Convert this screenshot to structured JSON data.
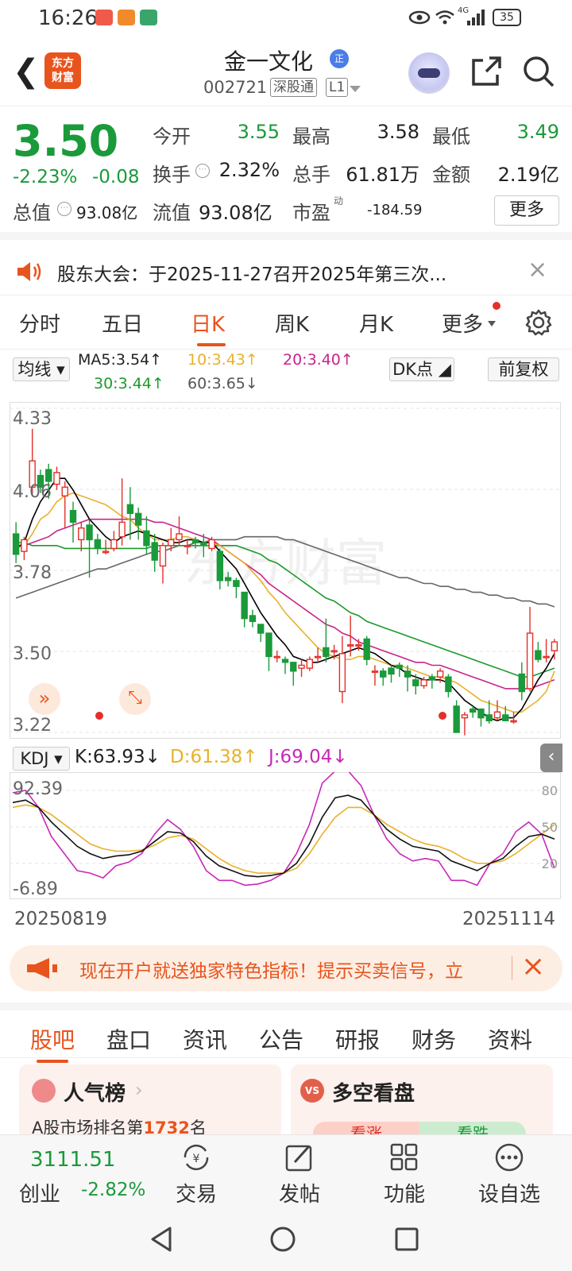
{
  "status_bar": {
    "time": "16:26",
    "battery": "35",
    "network": "4G"
  },
  "header": {
    "logo_text": "东方财富",
    "stock_name": "金一文化",
    "badge": "正",
    "stock_code": "002721",
    "tag_1": "深股通",
    "tag_2": "L1"
  },
  "quote": {
    "price": "3.50",
    "change_pct": "-2.23%",
    "change_amt": "-0.08",
    "open_label": "今开",
    "open_value": "3.55",
    "high_label": "最高",
    "high_value": "3.58",
    "low_label": "最低",
    "low_value": "3.49",
    "turnover_label": "换手",
    "turnover_value": "2.32%",
    "volume_label": "总手",
    "volume_value": "61.81万",
    "amount_label": "金额",
    "amount_value": "2.19亿",
    "total_value_label": "总值",
    "total_value_value": "93.08亿",
    "float_value_label": "流值",
    "float_value_value": "93.08亿",
    "pe_label": "市盈",
    "pe_sup": "动",
    "pe_value": "-184.59",
    "more_label": "更多"
  },
  "notice": {
    "text": "股东大会：于2025-11-27召开2025年第三次..."
  },
  "chart_tabs": [
    {
      "label": "分时"
    },
    {
      "label": "五日"
    },
    {
      "label": "日K"
    },
    {
      "label": "周K"
    },
    {
      "label": "月K"
    },
    {
      "label": "更多"
    }
  ],
  "ma_legend": {
    "selector": "均线",
    "ma5": "MA5:3.54↑",
    "ma10": "10:3.43↑",
    "ma20": "20:3.40↑",
    "ma30": "30:3.44↑",
    "ma60": "60:3.65↓",
    "dk_label": "DK点",
    "fq_label": "前复权"
  },
  "chart_data": {
    "type": "candlestick",
    "y_ticks": [
      "4.33",
      "4.06",
      "3.78",
      "3.50",
      "3.22"
    ],
    "ylim": [
      3.22,
      4.33
    ],
    "x_start_label": "20250819",
    "x_end_label": "20251114",
    "candles": [
      [
        3.9,
        3.83,
        3.94,
        3.8
      ],
      [
        3.84,
        3.88,
        3.89,
        3.81
      ],
      [
        4.06,
        4.15,
        4.26,
        4.03
      ],
      [
        4.1,
        4.06,
        4.12,
        4.04
      ],
      [
        4.12,
        4.08,
        4.14,
        4.02
      ],
      [
        4.07,
        4.11,
        4.13,
        4.05
      ],
      [
        4.03,
        4.06,
        4.08,
        3.92
      ],
      [
        3.98,
        3.94,
        4.01,
        3.87
      ],
      [
        3.88,
        3.92,
        3.94,
        3.84
      ],
      [
        3.93,
        3.88,
        3.95,
        3.75
      ],
      [
        3.88,
        3.85,
        3.9,
        3.83
      ],
      [
        3.84,
        3.84,
        3.88,
        3.83
      ],
      [
        3.85,
        3.88,
        3.91,
        3.84
      ],
      [
        3.89,
        3.94,
        4.09,
        3.86
      ],
      [
        4.0,
        3.97,
        4.06,
        3.88
      ],
      [
        3.97,
        3.93,
        3.99,
        3.88
      ],
      [
        3.91,
        3.86,
        3.96,
        3.83
      ],
      [
        3.87,
        3.81,
        3.9,
        3.77
      ],
      [
        3.79,
        3.86,
        3.87,
        3.73
      ],
      [
        3.86,
        3.88,
        3.92,
        3.84
      ],
      [
        3.88,
        3.9,
        3.96,
        3.86
      ],
      [
        3.86,
        3.86,
        3.88,
        3.83
      ],
      [
        3.88,
        3.87,
        3.89,
        3.85
      ],
      [
        3.87,
        3.86,
        3.9,
        3.82
      ],
      [
        3.85,
        3.88,
        3.89,
        3.84
      ],
      [
        3.84,
        3.74,
        3.85,
        3.71
      ],
      [
        3.75,
        3.74,
        3.77,
        3.72
      ],
      [
        3.74,
        3.72,
        3.75,
        3.68
      ],
      [
        3.7,
        3.61,
        3.7,
        3.58
      ],
      [
        3.62,
        3.6,
        3.64,
        3.58
      ],
      [
        3.59,
        3.56,
        3.59,
        3.53
      ],
      [
        3.56,
        3.48,
        3.56,
        3.43
      ],
      [
        3.48,
        3.48,
        3.5,
        3.46
      ],
      [
        3.47,
        3.46,
        3.48,
        3.42
      ],
      [
        3.46,
        3.43,
        3.46,
        3.38
      ],
      [
        3.44,
        3.45,
        3.47,
        3.41
      ],
      [
        3.44,
        3.47,
        3.48,
        3.43
      ],
      [
        3.48,
        3.48,
        3.51,
        3.46
      ],
      [
        3.51,
        3.48,
        3.61,
        3.46
      ],
      [
        3.5,
        3.5,
        3.52,
        3.47
      ],
      [
        3.36,
        3.49,
        3.55,
        3.32
      ],
      [
        3.52,
        3.52,
        3.62,
        3.48
      ],
      [
        3.52,
        3.52,
        3.54,
        3.5
      ],
      [
        3.54,
        3.47,
        3.55,
        3.45
      ],
      [
        3.43,
        3.43,
        3.45,
        3.38
      ],
      [
        3.43,
        3.41,
        3.44,
        3.38
      ],
      [
        3.44,
        3.42,
        3.45,
        3.39
      ],
      [
        3.45,
        3.44,
        3.46,
        3.41
      ],
      [
        3.43,
        3.41,
        3.45,
        3.36
      ],
      [
        3.4,
        3.38,
        3.42,
        3.35
      ],
      [
        3.38,
        3.4,
        3.41,
        3.37
      ],
      [
        3.41,
        3.4,
        3.42,
        3.37
      ],
      [
        3.41,
        3.43,
        3.44,
        3.39
      ],
      [
        3.41,
        3.36,
        3.42,
        3.34
      ],
      [
        3.31,
        3.22,
        3.33,
        3.22
      ],
      [
        3.27,
        3.28,
        3.29,
        3.21
      ],
      [
        3.3,
        3.29,
        3.31,
        3.27
      ],
      [
        3.3,
        3.27,
        3.3,
        3.24
      ],
      [
        3.28,
        3.26,
        3.33,
        3.25
      ],
      [
        3.27,
        3.29,
        3.33,
        3.26
      ],
      [
        3.28,
        3.26,
        3.31,
        3.26
      ],
      [
        3.26,
        3.26,
        3.29,
        3.25
      ],
      [
        3.42,
        3.36,
        3.46,
        3.33
      ],
      [
        3.37,
        3.56,
        3.65,
        3.36
      ],
      [
        3.5,
        3.47,
        3.53,
        3.46
      ],
      [
        3.48,
        3.48,
        3.54,
        3.46
      ],
      [
        3.5,
        3.53,
        3.54,
        3.47
      ]
    ],
    "ma5": [
      3.85,
      3.87,
      3.95,
      4.01,
      4.05,
      4.09,
      4.09,
      4.05,
      4.0,
      3.95,
      3.92,
      3.89,
      3.87,
      3.89,
      3.9,
      3.91,
      3.9,
      3.89,
      3.88,
      3.87,
      3.87,
      3.88,
      3.88,
      3.87,
      3.87,
      3.84,
      3.81,
      3.78,
      3.73,
      3.68,
      3.63,
      3.59,
      3.55,
      3.52,
      3.48,
      3.47,
      3.46,
      3.46,
      3.47,
      3.48,
      3.49,
      3.5,
      3.51,
      3.5,
      3.49,
      3.47,
      3.45,
      3.44,
      3.42,
      3.41,
      3.4,
      3.4,
      3.4,
      3.39,
      3.36,
      3.33,
      3.31,
      3.29,
      3.27,
      3.26,
      3.27,
      3.27,
      3.3,
      3.35,
      3.4,
      3.44,
      3.49
    ],
    "ma10": [
      3.85,
      3.86,
      3.9,
      3.95,
      3.97,
      4.01,
      4.03,
      4.04,
      4.03,
      4.02,
      4.01,
      4.0,
      3.98,
      3.96,
      3.95,
      3.92,
      3.9,
      3.88,
      3.88,
      3.88,
      3.89,
      3.89,
      3.88,
      3.87,
      3.87,
      3.86,
      3.84,
      3.82,
      3.8,
      3.77,
      3.74,
      3.7,
      3.67,
      3.63,
      3.6,
      3.57,
      3.54,
      3.51,
      3.49,
      3.48,
      3.47,
      3.47,
      3.48,
      3.48,
      3.47,
      3.46,
      3.45,
      3.45,
      3.44,
      3.43,
      3.42,
      3.41,
      3.41,
      3.4,
      3.39,
      3.37,
      3.35,
      3.33,
      3.32,
      3.31,
      3.3,
      3.29,
      3.29,
      3.31,
      3.33,
      3.36,
      3.43
    ],
    "ma20": [
      3.86,
      3.86,
      3.87,
      3.88,
      3.89,
      3.91,
      3.92,
      3.93,
      3.94,
      3.95,
      3.95,
      3.95,
      3.95,
      3.95,
      3.95,
      3.95,
      3.95,
      3.94,
      3.94,
      3.93,
      3.92,
      3.91,
      3.9,
      3.89,
      3.88,
      3.86,
      3.84,
      3.82,
      3.8,
      3.78,
      3.76,
      3.73,
      3.71,
      3.69,
      3.67,
      3.65,
      3.63,
      3.61,
      3.59,
      3.58,
      3.56,
      3.55,
      3.53,
      3.52,
      3.51,
      3.5,
      3.49,
      3.48,
      3.47,
      3.46,
      3.46,
      3.45,
      3.45,
      3.44,
      3.43,
      3.42,
      3.41,
      3.4,
      3.39,
      3.38,
      3.37,
      3.37,
      3.37,
      3.37,
      3.38,
      3.39,
      3.4
    ],
    "ma30": [
      3.87,
      3.87,
      3.86,
      3.86,
      3.86,
      3.86,
      3.85,
      3.85,
      3.85,
      3.85,
      3.85,
      3.85,
      3.85,
      3.85,
      3.85,
      3.85,
      3.85,
      3.86,
      3.86,
      3.86,
      3.86,
      3.86,
      3.86,
      3.86,
      3.86,
      3.86,
      3.86,
      3.86,
      3.85,
      3.84,
      3.83,
      3.81,
      3.8,
      3.78,
      3.76,
      3.74,
      3.72,
      3.7,
      3.68,
      3.67,
      3.65,
      3.63,
      3.62,
      3.6,
      3.59,
      3.58,
      3.57,
      3.56,
      3.55,
      3.54,
      3.53,
      3.52,
      3.51,
      3.5,
      3.49,
      3.48,
      3.47,
      3.46,
      3.45,
      3.44,
      3.43,
      3.42,
      3.41,
      3.41,
      3.42,
      3.43,
      3.44
    ],
    "ma60": [
      3.68,
      3.69,
      3.7,
      3.71,
      3.72,
      3.73,
      3.74,
      3.75,
      3.76,
      3.77,
      3.78,
      3.78,
      3.79,
      3.8,
      3.81,
      3.82,
      3.83,
      3.84,
      3.84,
      3.85,
      3.86,
      3.86,
      3.87,
      3.87,
      3.88,
      3.88,
      3.88,
      3.88,
      3.89,
      3.89,
      3.89,
      3.89,
      3.89,
      3.88,
      3.88,
      3.87,
      3.86,
      3.85,
      3.84,
      3.83,
      3.82,
      3.81,
      3.8,
      3.79,
      3.78,
      3.77,
      3.76,
      3.75,
      3.75,
      3.74,
      3.73,
      3.73,
      3.72,
      3.72,
      3.71,
      3.71,
      3.7,
      3.7,
      3.69,
      3.69,
      3.68,
      3.68,
      3.67,
      3.67,
      3.66,
      3.66,
      3.65
    ]
  },
  "kdj": {
    "selector": "KDJ",
    "k_label": "K:63.93↓",
    "d_label": "D:61.38↑",
    "j_label": "J:69.04↓",
    "y_top": "92.39",
    "y_bottom": "-6.89",
    "ylim": [
      -6.89,
      92.39
    ],
    "ref_80": "80",
    "ref_50": "50",
    "ref_20": "20",
    "k": [
      70,
      72,
      66,
      54,
      44,
      34,
      28,
      24,
      26,
      27,
      30,
      38,
      46,
      45,
      38,
      26,
      18,
      14,
      10,
      9,
      10,
      12,
      20,
      36,
      58,
      74,
      76,
      72,
      60,
      48,
      40,
      34,
      32,
      30,
      22,
      18,
      14,
      20,
      24,
      34,
      42,
      44,
      40
    ],
    "d": [
      66,
      68,
      66,
      60,
      52,
      44,
      36,
      32,
      30,
      30,
      31,
      35,
      41,
      43,
      40,
      32,
      24,
      18,
      14,
      12,
      12,
      12,
      16,
      28,
      44,
      58,
      66,
      66,
      60,
      52,
      46,
      40,
      36,
      34,
      30,
      24,
      20,
      20,
      22,
      28,
      36,
      44,
      52
    ],
    "j": [
      78,
      80,
      66,
      42,
      28,
      14,
      12,
      8,
      18,
      21,
      28,
      44,
      56,
      48,
      34,
      14,
      6,
      6,
      2,
      3,
      6,
      12,
      28,
      52,
      86,
      96,
      96,
      84,
      60,
      40,
      28,
      22,
      24,
      22,
      6,
      6,
      2,
      20,
      28,
      46,
      54,
      44,
      16
    ]
  },
  "ad": {
    "text": "现在开户就送独家特色指标！提示买卖信号，立"
  },
  "bottom_tabs": [
    {
      "label": "股吧"
    },
    {
      "label": "盘口"
    },
    {
      "label": "资讯"
    },
    {
      "label": "公告"
    },
    {
      "label": "研报"
    },
    {
      "label": "财务"
    },
    {
      "label": "资料"
    }
  ],
  "cards": {
    "popularity_title": "人气榜",
    "popularity_sub_prefix": "A股市场排名第",
    "popularity_rank": "1732",
    "popularity_sub_suffix": "名",
    "bullbear_title": "多空看盘",
    "bull_label": "看涨",
    "bear_label": "看跌"
  },
  "bottom_nav": {
    "index_value": "3111.51",
    "index_name": "创业",
    "index_change": "-2.82%",
    "trade_label": "交易",
    "post_label": "发帖",
    "func_label": "功能",
    "watch_label": "设自选"
  },
  "colors": {
    "up": "#e2302b",
    "down": "#1a9a3a",
    "accent": "#e8541d",
    "ma5": "#000000",
    "ma10": "#e8b12a",
    "ma20": "#c8248b",
    "ma30": "#1c9a2a",
    "ma60": "#666666"
  }
}
